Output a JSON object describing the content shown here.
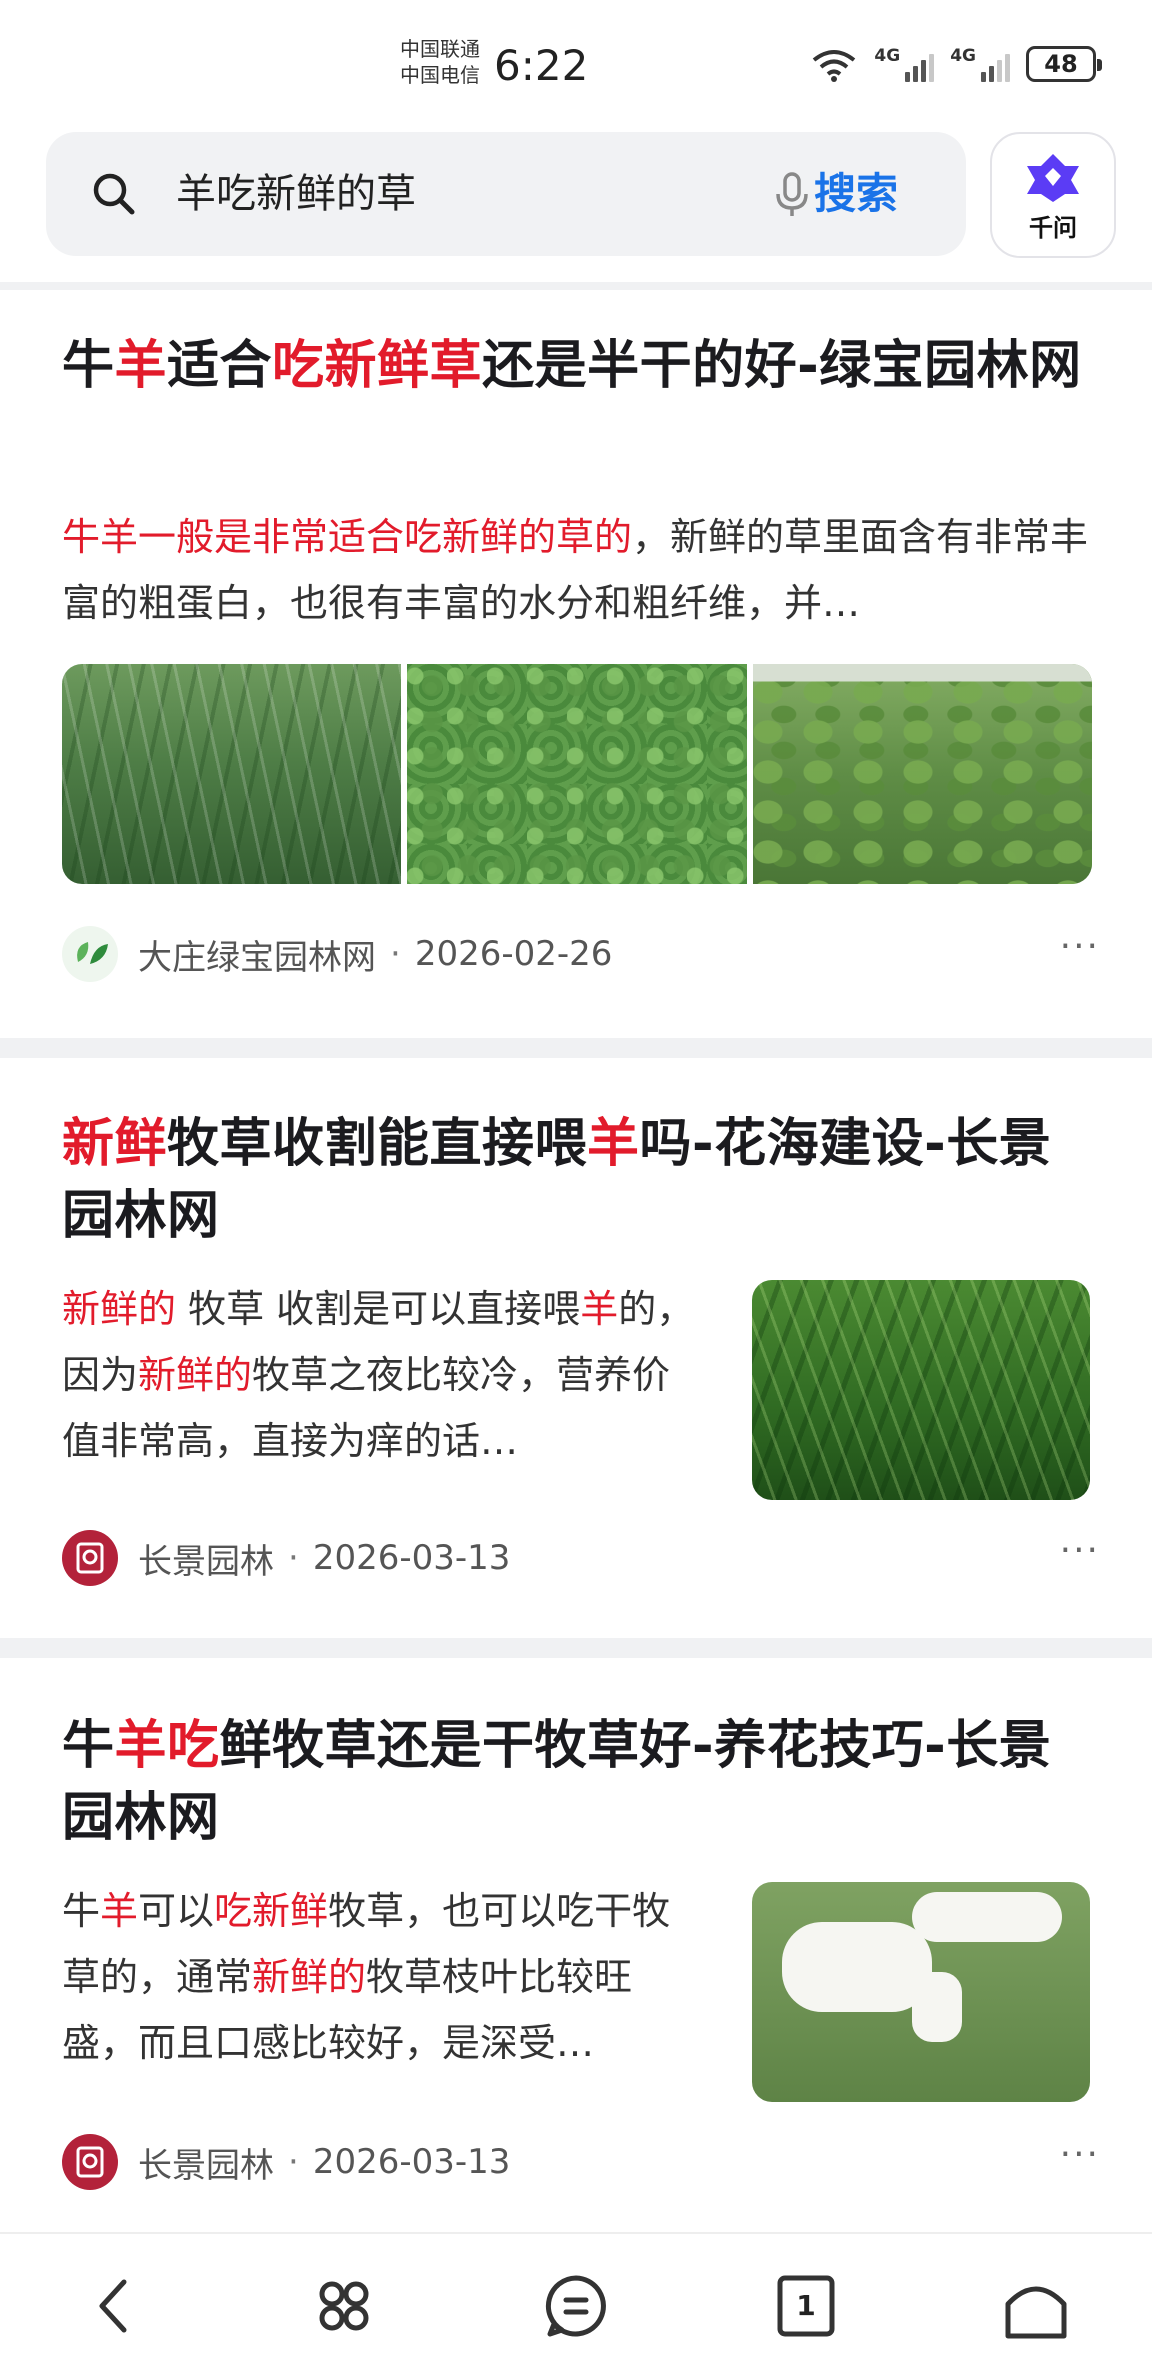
{
  "status_bar": {
    "carrier_1": "中国联通",
    "carrier_2": "中国电信",
    "time": "6:22",
    "network_1": "4G",
    "network_2": "4G",
    "battery": "48"
  },
  "search": {
    "query": "羊吃新鲜的草",
    "button_label": "搜索",
    "assistant_label": "千问"
  },
  "results": [
    {
      "title_parts": [
        {
          "text": "牛",
          "hl": false
        },
        {
          "text": "羊",
          "hl": true
        },
        {
          "text": "适合",
          "hl": false
        },
        {
          "text": "吃新鲜草",
          "hl": true
        },
        {
          "text": "还是半干的好-绿宝园林网",
          "hl": false
        }
      ],
      "snippet_parts": [
        {
          "text": "牛羊一般是非常适合吃新鲜的草的",
          "hl": true
        },
        {
          "text": "，新鲜的草里面含有非常丰富的粗蛋白，也很有丰富的水分和粗纤维，并…",
          "hl": false
        }
      ],
      "source": "大庄绿宝园林网",
      "date": "2026-02-26"
    },
    {
      "title_parts": [
        {
          "text": "新鲜",
          "hl": true
        },
        {
          "text": "牧草收割能直接喂",
          "hl": false
        },
        {
          "text": "羊",
          "hl": true
        },
        {
          "text": "吗-花海建设-长景园林网",
          "hl": false
        }
      ],
      "snippet_parts": [
        {
          "text": "新鲜的",
          "hl": true
        },
        {
          "text": " 牧草 收割是可以直接喂",
          "hl": false
        },
        {
          "text": "羊",
          "hl": true
        },
        {
          "text": "的，因为",
          "hl": false
        },
        {
          "text": "新鲜的",
          "hl": true
        },
        {
          "text": "牧草之夜比较冷，营养价值非常高，直接为痒的话…",
          "hl": false
        }
      ],
      "source": "长景园林",
      "date": "2026-03-13"
    },
    {
      "title_parts": [
        {
          "text": "牛",
          "hl": false
        },
        {
          "text": "羊吃",
          "hl": true
        },
        {
          "text": "鲜牧草还是干牧草好-养花技巧-长景园林网",
          "hl": false
        }
      ],
      "snippet_parts": [
        {
          "text": "牛",
          "hl": false
        },
        {
          "text": "羊",
          "hl": true
        },
        {
          "text": "可以",
          "hl": false
        },
        {
          "text": "吃新鲜",
          "hl": true
        },
        {
          "text": "牧草，也可以吃干牧草的，通常",
          "hl": false
        },
        {
          "text": "新鲜的",
          "hl": true
        },
        {
          "text": "牧草枝叶比较旺盛，而且口感比较好，是深受…",
          "hl": false
        }
      ],
      "source": "长景园林",
      "date": "2026-03-13"
    }
  ],
  "more_label": "···",
  "bottom_nav": {
    "tabs_count": "1"
  },
  "colors": {
    "highlight": "#e21b2b",
    "search_button": "#1a73e8"
  },
  "icons": [
    "search-icon",
    "mic-icon",
    "qianwen-logo-icon",
    "back-icon",
    "clover-icon",
    "menu-icon",
    "tabs-icon",
    "home-icon"
  ]
}
